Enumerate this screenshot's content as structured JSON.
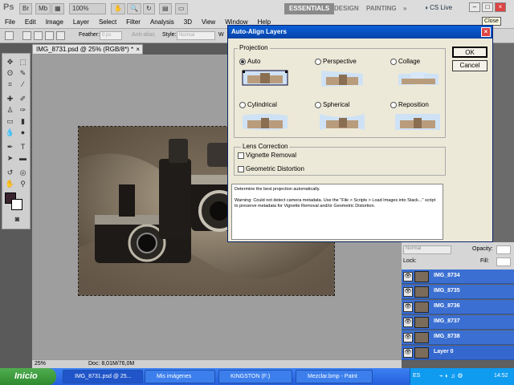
{
  "app": {
    "logo": "Ps",
    "zoom_btn": "100%",
    "workspaces": [
      "ESSENTIALS",
      "DESIGN",
      "PAINTING"
    ],
    "cs_live": "CS Live",
    "close_tooltip": "Close"
  },
  "menu": [
    "File",
    "Edit",
    "Image",
    "Layer",
    "Select",
    "Filter",
    "Analysis",
    "3D",
    "View",
    "Window",
    "Help"
  ],
  "options": {
    "feather_label": "Feather:",
    "feather_value": "0 px",
    "antialias_label": "Anti-alias",
    "style_label": "Style:",
    "style_value": "Normal",
    "width_label": "W"
  },
  "document": {
    "tab_title": "IMG_8731.psd @ 25% (RGB/8*) *",
    "status_zoom": "25%",
    "status_doc": "Doc: 8,01M/76,0M"
  },
  "dialog": {
    "title": "Auto-Align Layers",
    "projection_label": "Projection",
    "projections": [
      "Auto",
      "Perspective",
      "Collage",
      "Cylindrical",
      "Spherical",
      "Reposition"
    ],
    "selected_projection": "Auto",
    "lens_label": "Lens Correction",
    "vignette_label": "Vignette Removal",
    "geometric_label": "Geometric Distortion",
    "ok_label": "OK",
    "cancel_label": "Cancel",
    "info_line1": "Determine the best projection automatically.",
    "info_line2": "Warning: Could not detect camera metadata. Use the \"File > Scripts > Load Images into Stack...\" script to preserve metadata for Vignette Removal and/or Geometric Distortion."
  },
  "layers_panel": {
    "blend_mode": "Normal",
    "opacity_label": "Opacity:",
    "lock_label": "Lock:",
    "fill_label": "Fill:",
    "layers": [
      "IMG_8734",
      "IMG_8735",
      "IMG_8736",
      "IMG_8737",
      "IMG_8738",
      "Layer 0"
    ]
  },
  "taskbar": {
    "start": "Inicio",
    "tasks": [
      "IMG_8731.psd @ 25...",
      "Mis imágenes",
      "KINGSTON (F:)",
      "Mezclar.bmp - Paint"
    ],
    "lang": "ES",
    "clock": "14:52"
  }
}
